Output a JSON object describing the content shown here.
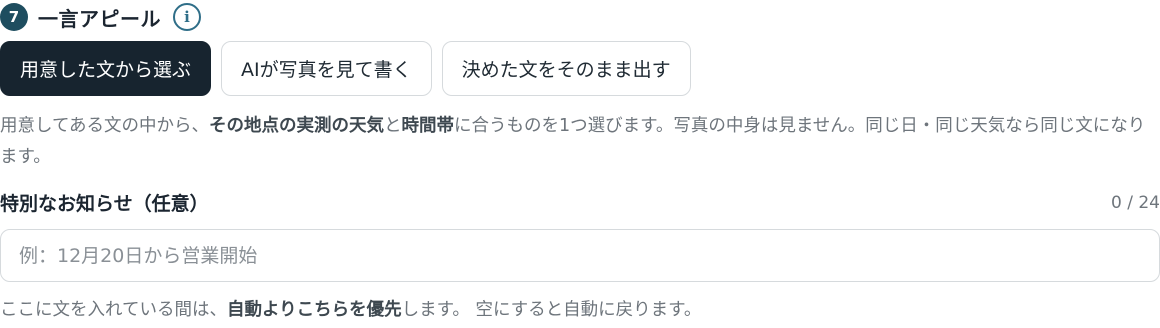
{
  "section": {
    "step_number": "7",
    "title": "一言アピール",
    "info_icon": "info-icon"
  },
  "modes": [
    {
      "label": "用意した文から選ぶ",
      "active": true
    },
    {
      "label": "AIが写真を見て書く",
      "active": false
    },
    {
      "label": "決めた文をそのまま出す",
      "active": false
    }
  ],
  "description": {
    "part1": "用意してある文の中から、",
    "bold1": "その地点の実測の天気",
    "part2": "と",
    "bold2": "時間帯",
    "part3": "に合うものを1つ選びます。写真の中身は見ません。同じ日・同じ天気なら同じ文になります。"
  },
  "notice": {
    "label": "特別なお知らせ（任意）",
    "count": "0 / 24",
    "value": "",
    "placeholder": "例：12月20日から営業開始"
  },
  "hint": {
    "part1": "ここに文を入れている間は、",
    "bold": "自動よりこちらを優先",
    "part2": "します。 空にすると自動に戻ります。"
  },
  "colors": {
    "badge": "#1e4d5f",
    "active_button": "#17242f",
    "border": "#d6dadd",
    "muted_text": "#6e757c"
  }
}
